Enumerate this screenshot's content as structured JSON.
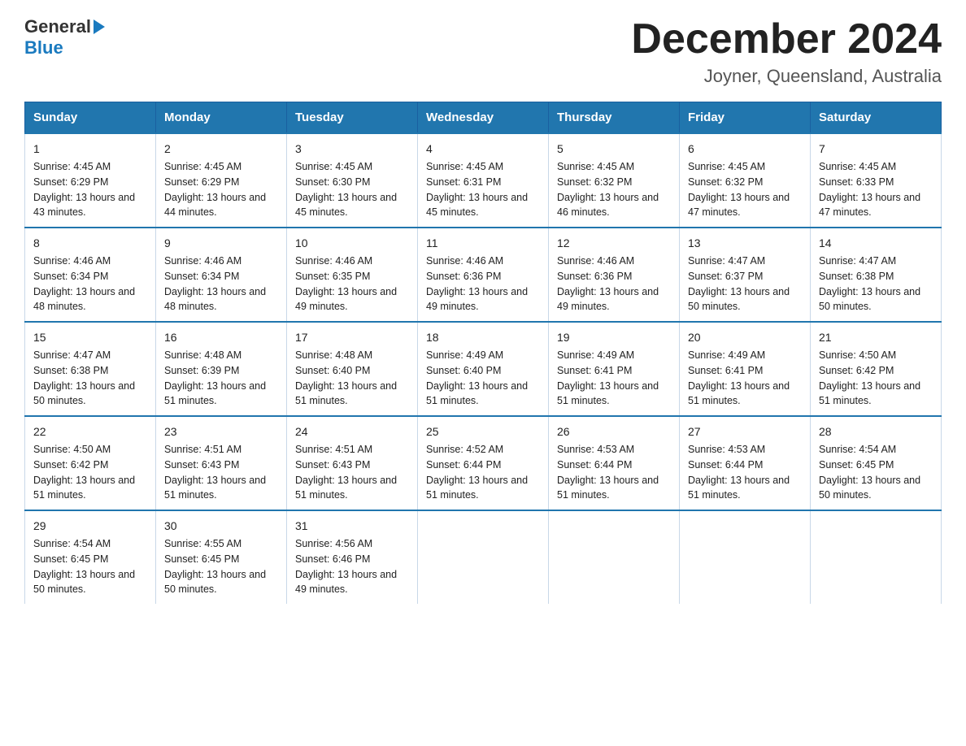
{
  "header": {
    "logo_general": "General",
    "logo_blue": "Blue",
    "month_title": "December 2024",
    "location": "Joyner, Queensland, Australia"
  },
  "days_of_week": [
    "Sunday",
    "Monday",
    "Tuesday",
    "Wednesday",
    "Thursday",
    "Friday",
    "Saturday"
  ],
  "weeks": [
    [
      {
        "day": "1",
        "sunrise": "4:45 AM",
        "sunset": "6:29 PM",
        "daylight": "13 hours and 43 minutes."
      },
      {
        "day": "2",
        "sunrise": "4:45 AM",
        "sunset": "6:29 PM",
        "daylight": "13 hours and 44 minutes."
      },
      {
        "day": "3",
        "sunrise": "4:45 AM",
        "sunset": "6:30 PM",
        "daylight": "13 hours and 45 minutes."
      },
      {
        "day": "4",
        "sunrise": "4:45 AM",
        "sunset": "6:31 PM",
        "daylight": "13 hours and 45 minutes."
      },
      {
        "day": "5",
        "sunrise": "4:45 AM",
        "sunset": "6:32 PM",
        "daylight": "13 hours and 46 minutes."
      },
      {
        "day": "6",
        "sunrise": "4:45 AM",
        "sunset": "6:32 PM",
        "daylight": "13 hours and 47 minutes."
      },
      {
        "day": "7",
        "sunrise": "4:45 AM",
        "sunset": "6:33 PM",
        "daylight": "13 hours and 47 minutes."
      }
    ],
    [
      {
        "day": "8",
        "sunrise": "4:46 AM",
        "sunset": "6:34 PM",
        "daylight": "13 hours and 48 minutes."
      },
      {
        "day": "9",
        "sunrise": "4:46 AM",
        "sunset": "6:34 PM",
        "daylight": "13 hours and 48 minutes."
      },
      {
        "day": "10",
        "sunrise": "4:46 AM",
        "sunset": "6:35 PM",
        "daylight": "13 hours and 49 minutes."
      },
      {
        "day": "11",
        "sunrise": "4:46 AM",
        "sunset": "6:36 PM",
        "daylight": "13 hours and 49 minutes."
      },
      {
        "day": "12",
        "sunrise": "4:46 AM",
        "sunset": "6:36 PM",
        "daylight": "13 hours and 49 minutes."
      },
      {
        "day": "13",
        "sunrise": "4:47 AM",
        "sunset": "6:37 PM",
        "daylight": "13 hours and 50 minutes."
      },
      {
        "day": "14",
        "sunrise": "4:47 AM",
        "sunset": "6:38 PM",
        "daylight": "13 hours and 50 minutes."
      }
    ],
    [
      {
        "day": "15",
        "sunrise": "4:47 AM",
        "sunset": "6:38 PM",
        "daylight": "13 hours and 50 minutes."
      },
      {
        "day": "16",
        "sunrise": "4:48 AM",
        "sunset": "6:39 PM",
        "daylight": "13 hours and 51 minutes."
      },
      {
        "day": "17",
        "sunrise": "4:48 AM",
        "sunset": "6:40 PM",
        "daylight": "13 hours and 51 minutes."
      },
      {
        "day": "18",
        "sunrise": "4:49 AM",
        "sunset": "6:40 PM",
        "daylight": "13 hours and 51 minutes."
      },
      {
        "day": "19",
        "sunrise": "4:49 AM",
        "sunset": "6:41 PM",
        "daylight": "13 hours and 51 minutes."
      },
      {
        "day": "20",
        "sunrise": "4:49 AM",
        "sunset": "6:41 PM",
        "daylight": "13 hours and 51 minutes."
      },
      {
        "day": "21",
        "sunrise": "4:50 AM",
        "sunset": "6:42 PM",
        "daylight": "13 hours and 51 minutes."
      }
    ],
    [
      {
        "day": "22",
        "sunrise": "4:50 AM",
        "sunset": "6:42 PM",
        "daylight": "13 hours and 51 minutes."
      },
      {
        "day": "23",
        "sunrise": "4:51 AM",
        "sunset": "6:43 PM",
        "daylight": "13 hours and 51 minutes."
      },
      {
        "day": "24",
        "sunrise": "4:51 AM",
        "sunset": "6:43 PM",
        "daylight": "13 hours and 51 minutes."
      },
      {
        "day": "25",
        "sunrise": "4:52 AM",
        "sunset": "6:44 PM",
        "daylight": "13 hours and 51 minutes."
      },
      {
        "day": "26",
        "sunrise": "4:53 AM",
        "sunset": "6:44 PM",
        "daylight": "13 hours and 51 minutes."
      },
      {
        "day": "27",
        "sunrise": "4:53 AM",
        "sunset": "6:44 PM",
        "daylight": "13 hours and 51 minutes."
      },
      {
        "day": "28",
        "sunrise": "4:54 AM",
        "sunset": "6:45 PM",
        "daylight": "13 hours and 50 minutes."
      }
    ],
    [
      {
        "day": "29",
        "sunrise": "4:54 AM",
        "sunset": "6:45 PM",
        "daylight": "13 hours and 50 minutes."
      },
      {
        "day": "30",
        "sunrise": "4:55 AM",
        "sunset": "6:45 PM",
        "daylight": "13 hours and 50 minutes."
      },
      {
        "day": "31",
        "sunrise": "4:56 AM",
        "sunset": "6:46 PM",
        "daylight": "13 hours and 49 minutes."
      },
      null,
      null,
      null,
      null
    ]
  ]
}
